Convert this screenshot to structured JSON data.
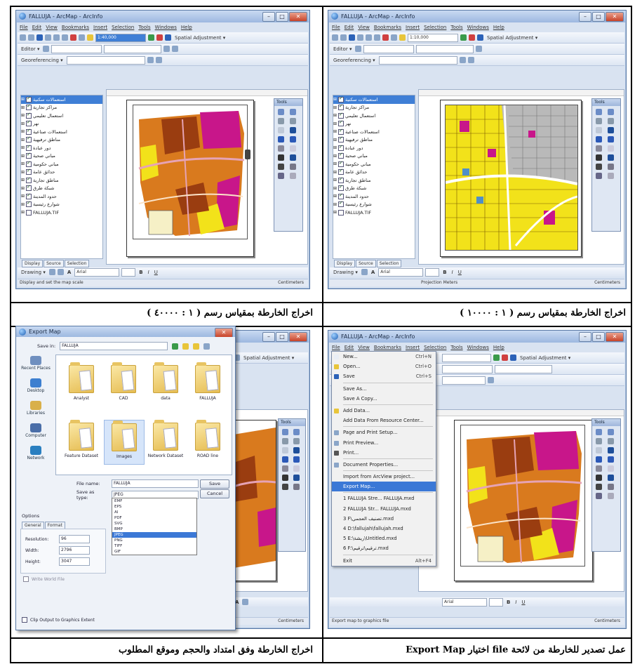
{
  "captions": {
    "top_right": "اخراج الخارطة بمقياس رسم ( ١ : ١٠٠٠٠ )",
    "top_left": "اخراج الخارطة بمقياس رسم ( ١ : ٤٠٠٠٠ )",
    "bottom_right": "عمل تصدير للخارطة من لائحة file اختيار Export Map",
    "bottom_left": "اخراج الخارطة وفق امتداد والحجم وموقع المطلوب"
  },
  "arcmap": {
    "title": "FALLUJA - ArcMap - ArcInfo",
    "menu": [
      "File",
      "Edit",
      "View",
      "Bookmarks",
      "Insert",
      "Selection",
      "Tools",
      "Windows",
      "Help"
    ],
    "scale_top_left": "1:40,000",
    "scale_top_right": "1:10,000",
    "spatial_adjustment": "Spatial Adjustment ▾",
    "editor": "Editor ▾",
    "georeferencing": "Georeferencing ▾",
    "drawing": "Drawing ▾",
    "font_box": "Arial",
    "status_left": "Display and set the map scale",
    "status_coords": "Projection Meters",
    "status_units": "Centimeters",
    "tools_title": "Tools",
    "toc_tabs": [
      "Display",
      "Source",
      "Selection"
    ],
    "layers": [
      "استعمالات سكنية",
      "مراكز تجارية",
      "استعمال تعليمي",
      "نهر",
      "استعمالات صناعية",
      "مناطق ترفيهية",
      "دور عبادة",
      "مباني صحية",
      "مباني حكومية",
      "حدائق عامة",
      "مناطق تجارية",
      "شبكة طرق",
      "حدود المدينة",
      "شوارع رئيسية",
      "FALLUJA.TIF"
    ]
  },
  "file_menu": [
    {
      "label": "New...",
      "shortcut": "Ctrl+N"
    },
    {
      "label": "Open...",
      "shortcut": "Ctrl+O"
    },
    {
      "label": "Save",
      "shortcut": "Ctrl+S"
    },
    {
      "label": "Save As...",
      "shortcut": ""
    },
    {
      "label": "Save A Copy...",
      "shortcut": ""
    },
    {
      "label": "Add Data...",
      "shortcut": ""
    },
    {
      "label": "Add Data From Resource Center...",
      "shortcut": ""
    },
    {
      "label": "Page and Print Setup...",
      "shortcut": ""
    },
    {
      "label": "Print Preview...",
      "shortcut": ""
    },
    {
      "label": "Print...",
      "shortcut": ""
    },
    {
      "label": "Document Properties...",
      "shortcut": ""
    },
    {
      "label": "Import from ArcView project...",
      "shortcut": ""
    },
    {
      "label": "Export Map...",
      "shortcut": ""
    },
    {
      "label": "1 FALLUJA Stre... FALLUJA.mxd",
      "shortcut": ""
    },
    {
      "label": "2 FALLUJA Str... FALLUJA.mxd",
      "shortcut": ""
    },
    {
      "label": "3 F\\تصنيف العجمي.mxd",
      "shortcut": ""
    },
    {
      "label": "4 D:\\fallujah\\fallujah.mxd",
      "shortcut": ""
    },
    {
      "label": "5 E:\\ريشة\\Untitled.mxd",
      "shortcut": ""
    },
    {
      "label": "6 F:\\ترقيم\\ترقيم.mxd",
      "shortcut": ""
    },
    {
      "label": "Exit",
      "shortcut": "Alt+F4"
    }
  ],
  "file_menu_status": "Export map to graphics file",
  "export_dialog": {
    "title": "Export Map",
    "save_in_label": "Save in:",
    "save_in_value": "FALLUJA",
    "places": [
      "Recent Places",
      "Desktop",
      "Libraries",
      "Computer",
      "Network"
    ],
    "folders": [
      "Analyst",
      "CAD",
      "data",
      "FALLUJA",
      "Feature Dataset",
      "Images",
      "Network Dataset",
      "ROAD line"
    ],
    "file_name_label": "File name:",
    "file_name_value": "FALLUJA",
    "save_as_type_label": "Save as type:",
    "save_as_type_value": "JPEG",
    "save_button": "Save",
    "cancel_button": "Cancel",
    "type_options": [
      "EMF",
      "EPS",
      "AI",
      "PDF",
      "SVG",
      "BMP",
      "JPEG",
      "PNG",
      "TIFF",
      "GIF"
    ],
    "selected_type_index": 6,
    "options_label": "Options",
    "tabs": [
      "General",
      "Format"
    ],
    "resolution_label": "Resolution:",
    "resolution_value": "96",
    "width_label": "Width:",
    "width_value": "2796",
    "height_label": "Height:",
    "height_value": "3047",
    "background_label": "Write World File",
    "clip_label": "Clip Output to Graphics Extent"
  },
  "colors": {
    "map_orange": "#d97a1e",
    "map_brown": "#9a3d10",
    "map_yellow": "#f2e21a",
    "map_magenta": "#c8168a",
    "map_gray": "#b9b9b9",
    "window_blue": "#d9e3f1",
    "highlight": "#3b78d6"
  }
}
